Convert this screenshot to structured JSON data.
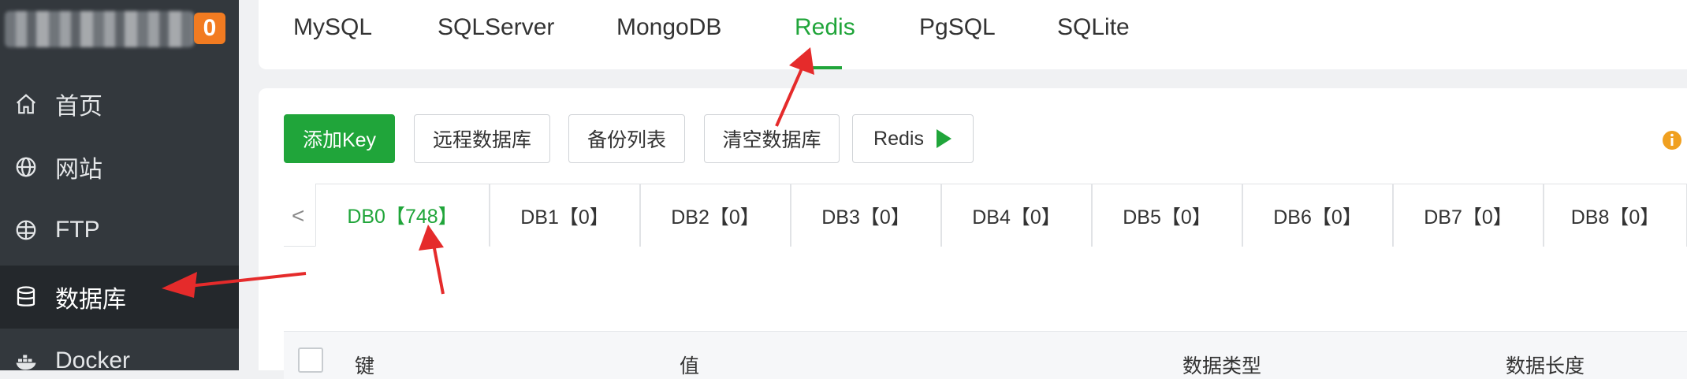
{
  "sidebar": {
    "badge": "0",
    "items": [
      {
        "label": "首页",
        "icon": "home-icon"
      },
      {
        "label": "网站",
        "icon": "globe-icon"
      },
      {
        "label": "FTP",
        "icon": "ftp-globe-icon"
      },
      {
        "label": "数据库",
        "icon": "database-icon",
        "active": true
      },
      {
        "label": "Docker",
        "icon": "docker-icon"
      }
    ]
  },
  "topbar": {
    "tabs": [
      "MySQL",
      "SQLServer",
      "MongoDB",
      "Redis",
      "PgSQL",
      "SQLite"
    ],
    "active_tab": "Redis"
  },
  "toolbar": {
    "add_key": "添加Key",
    "remote_db": "远程数据库",
    "backup_list": "备份列表",
    "clear_db": "清空数据库",
    "redis": "Redis"
  },
  "db_tabs": [
    "DB0【748】",
    "DB1【0】",
    "DB2【0】",
    "DB3【0】",
    "DB4【0】",
    "DB5【0】",
    "DB6【0】",
    "DB7【0】",
    "DB8【0】"
  ],
  "active_db": "DB0【748】",
  "table": {
    "headers": [
      "键",
      "值",
      "数据类型",
      "数据长度"
    ]
  },
  "colors": {
    "accent": "#20a53a",
    "sidebar": "#33383d",
    "annotation": "#e52b2b",
    "info": "#f0a020"
  }
}
